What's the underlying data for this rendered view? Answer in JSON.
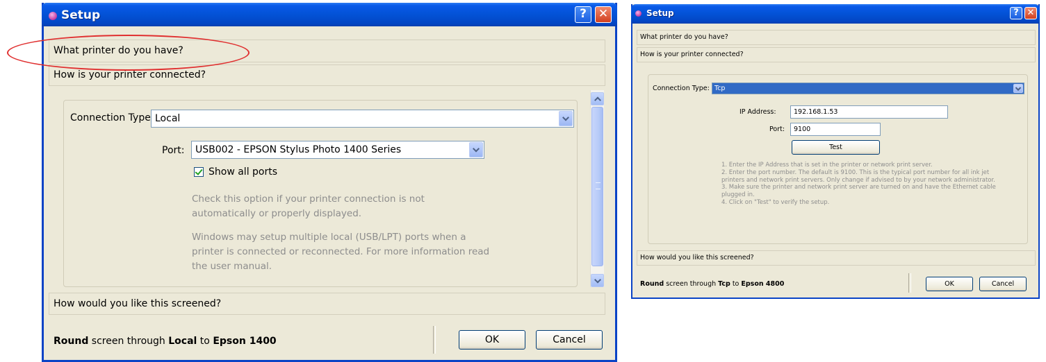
{
  "left_window": {
    "title": "Setup",
    "help_glyph": "?",
    "close_glyph": "✕",
    "sections": {
      "printer": "What printer do you have?",
      "connection": "How is your printer connected?",
      "screened": "How would you like this screened?"
    },
    "connection_type_label": "Connection Type:",
    "connection_type_value": "Local",
    "port_label": "Port:",
    "port_value": "USB002 - EPSON Stylus Photo 1400 Series",
    "show_all_ports_label": "Show all ports",
    "show_all_ports_checked": true,
    "help_text_1": "Check this option if your printer connection is not automatically or properly displayed.",
    "help_text_2": "Windows may setup multiple local (USB/LPT) ports when a printer is connected or reconnected. For more information read the user manual.",
    "footer": {
      "screen": "Round",
      "through": " screen through ",
      "connection": "Local",
      "to": " to ",
      "printer": "Epson 1400"
    },
    "ok_label": "OK",
    "cancel_label": "Cancel"
  },
  "right_window": {
    "title": "Setup",
    "help_glyph": "?",
    "close_glyph": "✕",
    "sections": {
      "printer": "What printer do you have?",
      "connection": "How is your printer connected?",
      "screened": "How would you like this screened?"
    },
    "connection_type_label": "Connection Type:",
    "connection_type_value": "Tcp",
    "ip_label": "IP Address:",
    "ip_value": "192.168.1.53",
    "port_label": "Port:",
    "port_value": "9100",
    "test_label": "Test",
    "instructions": [
      "1. Enter the IP Address that is set in the printer or network print server.",
      "2. Enter the port number. The default is 9100. This is the typical port number for all ink jet printers and network print servers. Only change if advised to by your network administrator.",
      "3. Make sure the printer and network print server are turned on and have the Ethernet cable plugged in.",
      "4. Click on \"Test\" to verify the setup."
    ],
    "footer": {
      "screen": "Round",
      "through": " screen through ",
      "connection": "Tcp",
      "to": " to ",
      "printer": "Epson 4800"
    },
    "ok_label": "OK",
    "cancel_label": "Cancel"
  },
  "colors": {
    "titlebar": "#0352d6",
    "dialog_bg": "#ece9d8",
    "annotation": "#e03030",
    "selection": "#316ac5"
  }
}
